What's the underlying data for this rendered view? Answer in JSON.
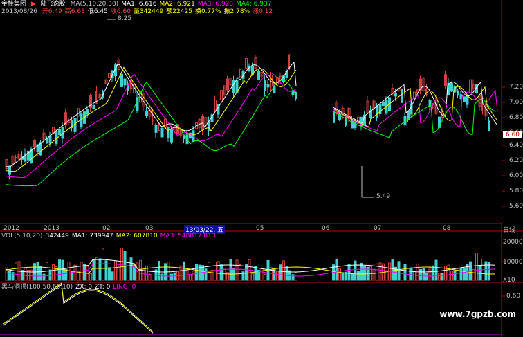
{
  "header": {
    "app_label": "金桂集团",
    "stock_name": "陆飞逸胶",
    "ma_line": [
      {
        "text": "MA(5,10,20,30)",
        "color": "#c0c0c0"
      },
      {
        "text": "MA1: 6.616",
        "color": "#ffffff"
      },
      {
        "text": "MA2: 6.921",
        "color": "#ffff00"
      },
      {
        "text": "MA3: 6.923",
        "color": "#ff00ff"
      },
      {
        "text": "MA4: 6.937",
        "color": "#00ff00"
      }
    ],
    "date": "2013/08/26",
    "quote_line": [
      {
        "text": "开6.49",
        "color": "#ff4040"
      },
      {
        "text": "高6.63",
        "color": "#ff4040"
      },
      {
        "text": "低6.45",
        "color": "#ffffff"
      },
      {
        "text": "收6.60",
        "color": "#ff4040"
      },
      {
        "text": "量342449",
        "color": "#ffff00"
      },
      {
        "text": "额22425",
        "color": "#ffff00"
      },
      {
        "text": "换0.77%",
        "color": "#ffff00"
      },
      {
        "text": "振2.78%",
        "color": "#ffff00"
      },
      {
        "text": "涨0.12",
        "color": "#ff4040"
      }
    ]
  },
  "price_axis": {
    "ticks": [
      "7.20",
      "7.00",
      "6.80",
      "6.60",
      "6.40",
      "6.20",
      "6.00",
      "5.80",
      "5.60"
    ],
    "current_price": "6.60",
    "high_annotation": "8.25",
    "low_annotation": "5.49"
  },
  "x_axis": {
    "labels": [
      "2012",
      "2013",
      "02",
      "03",
      "13/03/22, 五",
      "05",
      "06",
      "07",
      "08"
    ],
    "period_label": "日线"
  },
  "volume_panel": {
    "header": [
      {
        "text": "VOL(5,10,20)",
        "color": "#c0c0c0"
      },
      {
        "text": "342449",
        "color": "#ffffff"
      },
      {
        "text": "MA1: 739947",
        "color": "#ffffff"
      },
      {
        "text": "MA2: 607810",
        "color": "#ffff00"
      },
      {
        "text": "MA3: 548817.813",
        "color": "#ff00ff"
      }
    ],
    "ticks": [
      "200000",
      "100000"
    ],
    "unit": "X10"
  },
  "indicator_panel": {
    "header": [
      {
        "text": "黑马洞顶(100,50,60,10)",
        "color": "#c0c0c0"
      },
      {
        "text": "ZX: 0",
        "color": "#ffffff"
      },
      {
        "text": "ZT: 0",
        "color": "#ffffff"
      },
      {
        "text": "LING: 0",
        "color": "#ff00ff"
      }
    ],
    "ticks": [
      "0.60"
    ]
  },
  "watermark": "www.7gpzb.com",
  "colors": {
    "up": "#d04040",
    "down": "#40d0d0",
    "ma1": "#ffffff",
    "ma2": "#ffff00",
    "ma3": "#ff00ff",
    "ma4": "#00ff00",
    "axis": "#c00000"
  }
}
